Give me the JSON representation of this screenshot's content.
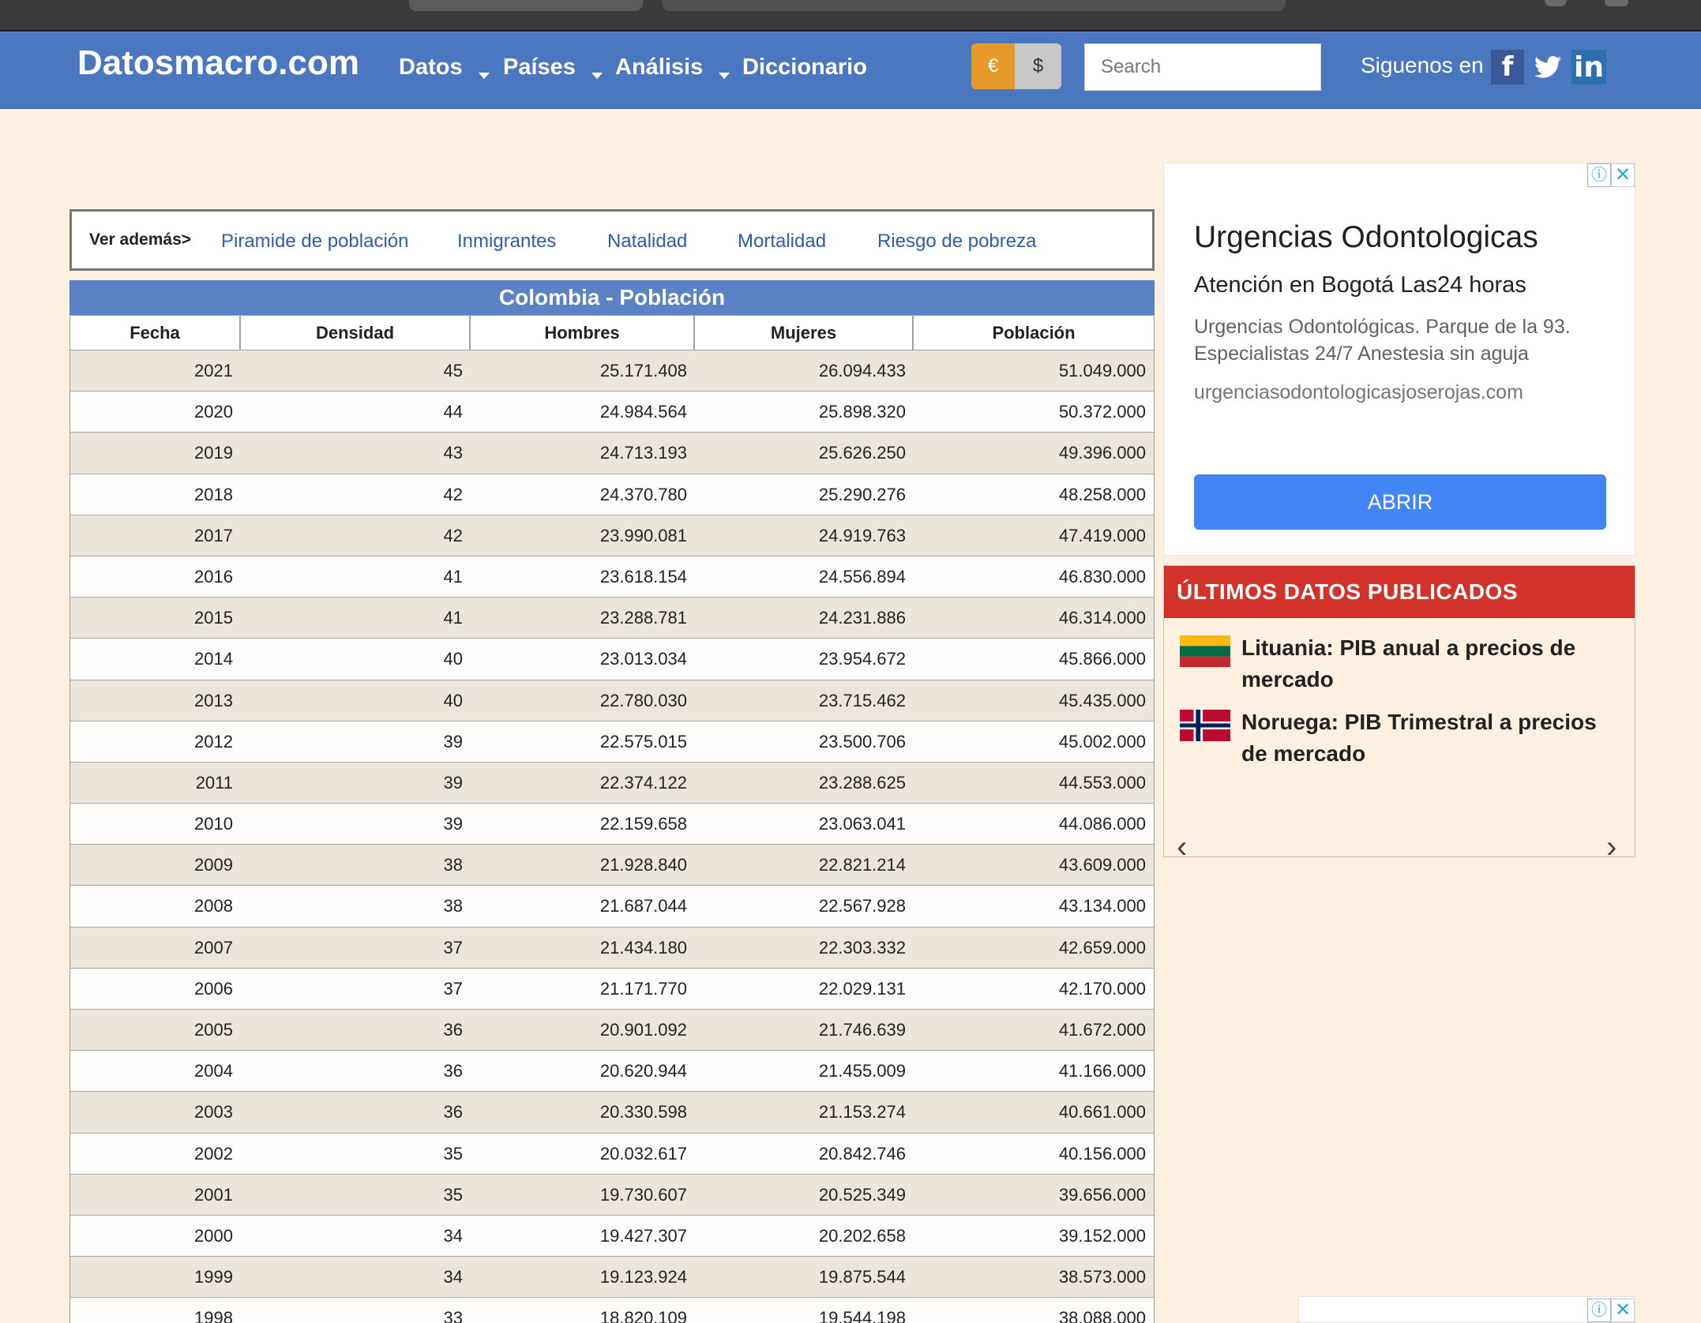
{
  "navbar": {
    "brand": "Datosmacro.com",
    "menu": [
      "Datos",
      "Países",
      "Análisis",
      "Diccionario"
    ],
    "currency_euro": "€",
    "currency_dollar": "$",
    "search_placeholder": "Search",
    "follow_label": "Siguenos en",
    "social_fb": "f",
    "social_in": "in"
  },
  "see_also": {
    "label": "Ver además>",
    "links": [
      "Piramide de población",
      "Inmigrantes",
      "Natalidad",
      "Mortalidad",
      "Riesgo de pobreza"
    ]
  },
  "table": {
    "title": "Colombia - Población",
    "headers": [
      "Fecha",
      "Densidad",
      "Hombres",
      "Mujeres",
      "Población"
    ],
    "rows": [
      [
        "2021",
        "45",
        "25.171.408",
        "26.094.433",
        "51.049.000"
      ],
      [
        "2020",
        "44",
        "24.984.564",
        "25.898.320",
        "50.372.000"
      ],
      [
        "2019",
        "43",
        "24.713.193",
        "25.626.250",
        "49.396.000"
      ],
      [
        "2018",
        "42",
        "24.370.780",
        "25.290.276",
        "48.258.000"
      ],
      [
        "2017",
        "42",
        "23.990.081",
        "24.919.763",
        "47.419.000"
      ],
      [
        "2016",
        "41",
        "23.618.154",
        "24.556.894",
        "46.830.000"
      ],
      [
        "2015",
        "41",
        "23.288.781",
        "24.231.886",
        "46.314.000"
      ],
      [
        "2014",
        "40",
        "23.013.034",
        "23.954.672",
        "45.866.000"
      ],
      [
        "2013",
        "40",
        "22.780.030",
        "23.715.462",
        "45.435.000"
      ],
      [
        "2012",
        "39",
        "22.575.015",
        "23.500.706",
        "45.002.000"
      ],
      [
        "2011",
        "39",
        "22.374.122",
        "23.288.625",
        "44.553.000"
      ],
      [
        "2010",
        "39",
        "22.159.658",
        "23.063.041",
        "44.086.000"
      ],
      [
        "2009",
        "38",
        "21.928.840",
        "22.821.214",
        "43.609.000"
      ],
      [
        "2008",
        "38",
        "21.687.044",
        "22.567.928",
        "43.134.000"
      ],
      [
        "2007",
        "37",
        "21.434.180",
        "22.303.332",
        "42.659.000"
      ],
      [
        "2006",
        "37",
        "21.171.770",
        "22.029.131",
        "42.170.000"
      ],
      [
        "2005",
        "36",
        "20.901.092",
        "21.746.639",
        "41.672.000"
      ],
      [
        "2004",
        "36",
        "20.620.944",
        "21.455.009",
        "41.166.000"
      ],
      [
        "2003",
        "36",
        "20.330.598",
        "21.153.274",
        "40.661.000"
      ],
      [
        "2002",
        "35",
        "20.032.617",
        "20.842.746",
        "40.156.000"
      ],
      [
        "2001",
        "35",
        "19.730.607",
        "20.525.349",
        "39.656.000"
      ],
      [
        "2000",
        "34",
        "19.427.307",
        "20.202.658",
        "39.152.000"
      ],
      [
        "1999",
        "34",
        "19.123.924",
        "19.875.544",
        "38.573.000"
      ],
      [
        "1998",
        "33",
        "18.820.109",
        "19.544.198",
        "38.088.000"
      ]
    ]
  },
  "ad": {
    "info_icon": "ⓘ",
    "close_icon": "✕",
    "headline": "Urgencias Odontologicas",
    "subheadline": "Atención en Bogotá Las24 horas",
    "description": "Urgencias Odontológicas. Parque de la 93. Especialistas 24/7 Anestesia sin aguja",
    "url": "urgenciasodontologicasjoserojas.com",
    "button": "ABRIR"
  },
  "latest": {
    "title": "ÚLTIMOS DATOS PUBLICADOS",
    "items": [
      {
        "text": "Lituania: PIB anual a precios de mercado",
        "flag": "lithuania-flag",
        "colors": [
          "#fdb913",
          "#006a44",
          "#c1272d"
        ]
      },
      {
        "text": "Noruega: PIB Trimestral a precios de mercado",
        "flag": "norway-flag",
        "colors": [
          "#ba0c2f",
          "#ffffff",
          "#00205b"
        ]
      }
    ],
    "prev": "‹",
    "next": "›"
  }
}
